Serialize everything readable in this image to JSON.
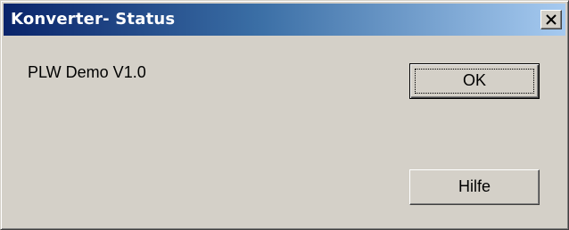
{
  "window": {
    "title": "Konverter- Status",
    "close_label": "Close"
  },
  "content": {
    "status_text": "PLW Demo V1.0"
  },
  "buttons": {
    "ok_label": "OK",
    "help_label": "Hilfe"
  },
  "colors": {
    "dialog_background": "#d4d0c8",
    "titlebar_start": "#0a246a",
    "titlebar_end": "#a6caf0",
    "title_text": "#ffffff"
  },
  "icons": {
    "close": "close-icon"
  }
}
